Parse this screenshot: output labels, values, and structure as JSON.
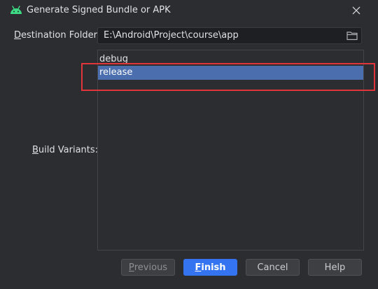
{
  "window": {
    "title": "Generate Signed Bundle or APK",
    "app_icon": "android-icon",
    "close_icon": "close-icon"
  },
  "destination": {
    "label_mnemonic": "D",
    "label_rest": "estination Folder:",
    "path": "E:\\Android\\Project\\course\\app",
    "browse_icon": "folder-icon"
  },
  "variants": {
    "label_mnemonic": "B",
    "label_rest": "uild Variants:",
    "items": [
      {
        "label": "debug",
        "selected": false
      },
      {
        "label": "release",
        "selected": true
      }
    ]
  },
  "buttons": {
    "previous": {
      "mnemonic": "P",
      "rest": "revious"
    },
    "finish": {
      "mnemonic": "F",
      "rest": "inish"
    },
    "cancel": "Cancel",
    "help": "Help"
  },
  "colors": {
    "background": "#2b2d30",
    "selection": "#4b6eaf",
    "primary_button": "#3574f0",
    "annotation_box": "#e0353a",
    "android_green": "#3ddc84"
  }
}
